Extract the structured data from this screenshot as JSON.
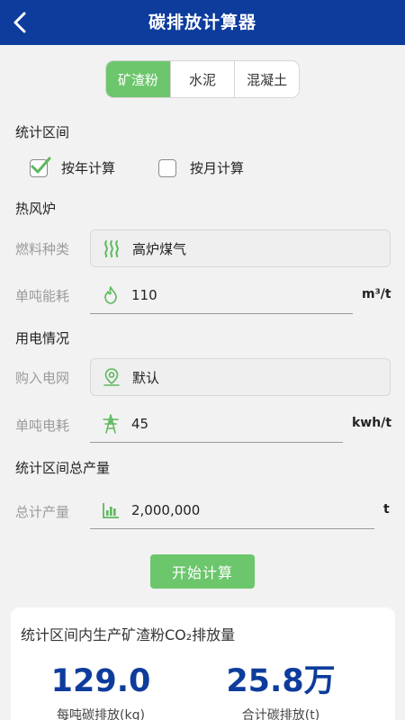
{
  "header": {
    "title": "碳排放计算器"
  },
  "tabs": [
    {
      "label": "矿渣粉",
      "active": true
    },
    {
      "label": "水泥",
      "active": false
    },
    {
      "label": "混凝土",
      "active": false
    }
  ],
  "period": {
    "section": "统计区间",
    "options": [
      {
        "label": "按年计算",
        "checked": true
      },
      {
        "label": "按月计算",
        "checked": false
      }
    ]
  },
  "hot_stove": {
    "section": "热风炉",
    "fuel_label": "燃料种类",
    "fuel_value": "高炉煤气",
    "energy_label": "单吨能耗",
    "energy_value": "110",
    "energy_unit": "m³/t"
  },
  "electricity": {
    "section": "用电情况",
    "grid_label": "购入电网",
    "grid_value": "默认",
    "power_label": "单吨电耗",
    "power_value": "45",
    "power_unit": "kwh/t"
  },
  "output": {
    "section": "统计区间总产量",
    "total_label": "总计产量",
    "total_value": "2,000,000",
    "total_unit": "t"
  },
  "start_button": "开始计算",
  "result": {
    "title": "统计区间内生产矿渣粉CO₂排放量",
    "per_ton_value": "129.0",
    "per_ton_caption": "每吨碳排放(kg)",
    "total_value": "25.8万",
    "total_caption": "合计碳排放(t)"
  },
  "colors": {
    "primary": "#0d3c9c",
    "accent": "#6cc66c"
  },
  "icons": {
    "back": "chevron-left-icon",
    "fuel": "heat-waves-icon",
    "energy": "flame-icon",
    "grid": "location-pin-icon",
    "power": "power-tower-icon",
    "output": "bar-chart-icon"
  }
}
